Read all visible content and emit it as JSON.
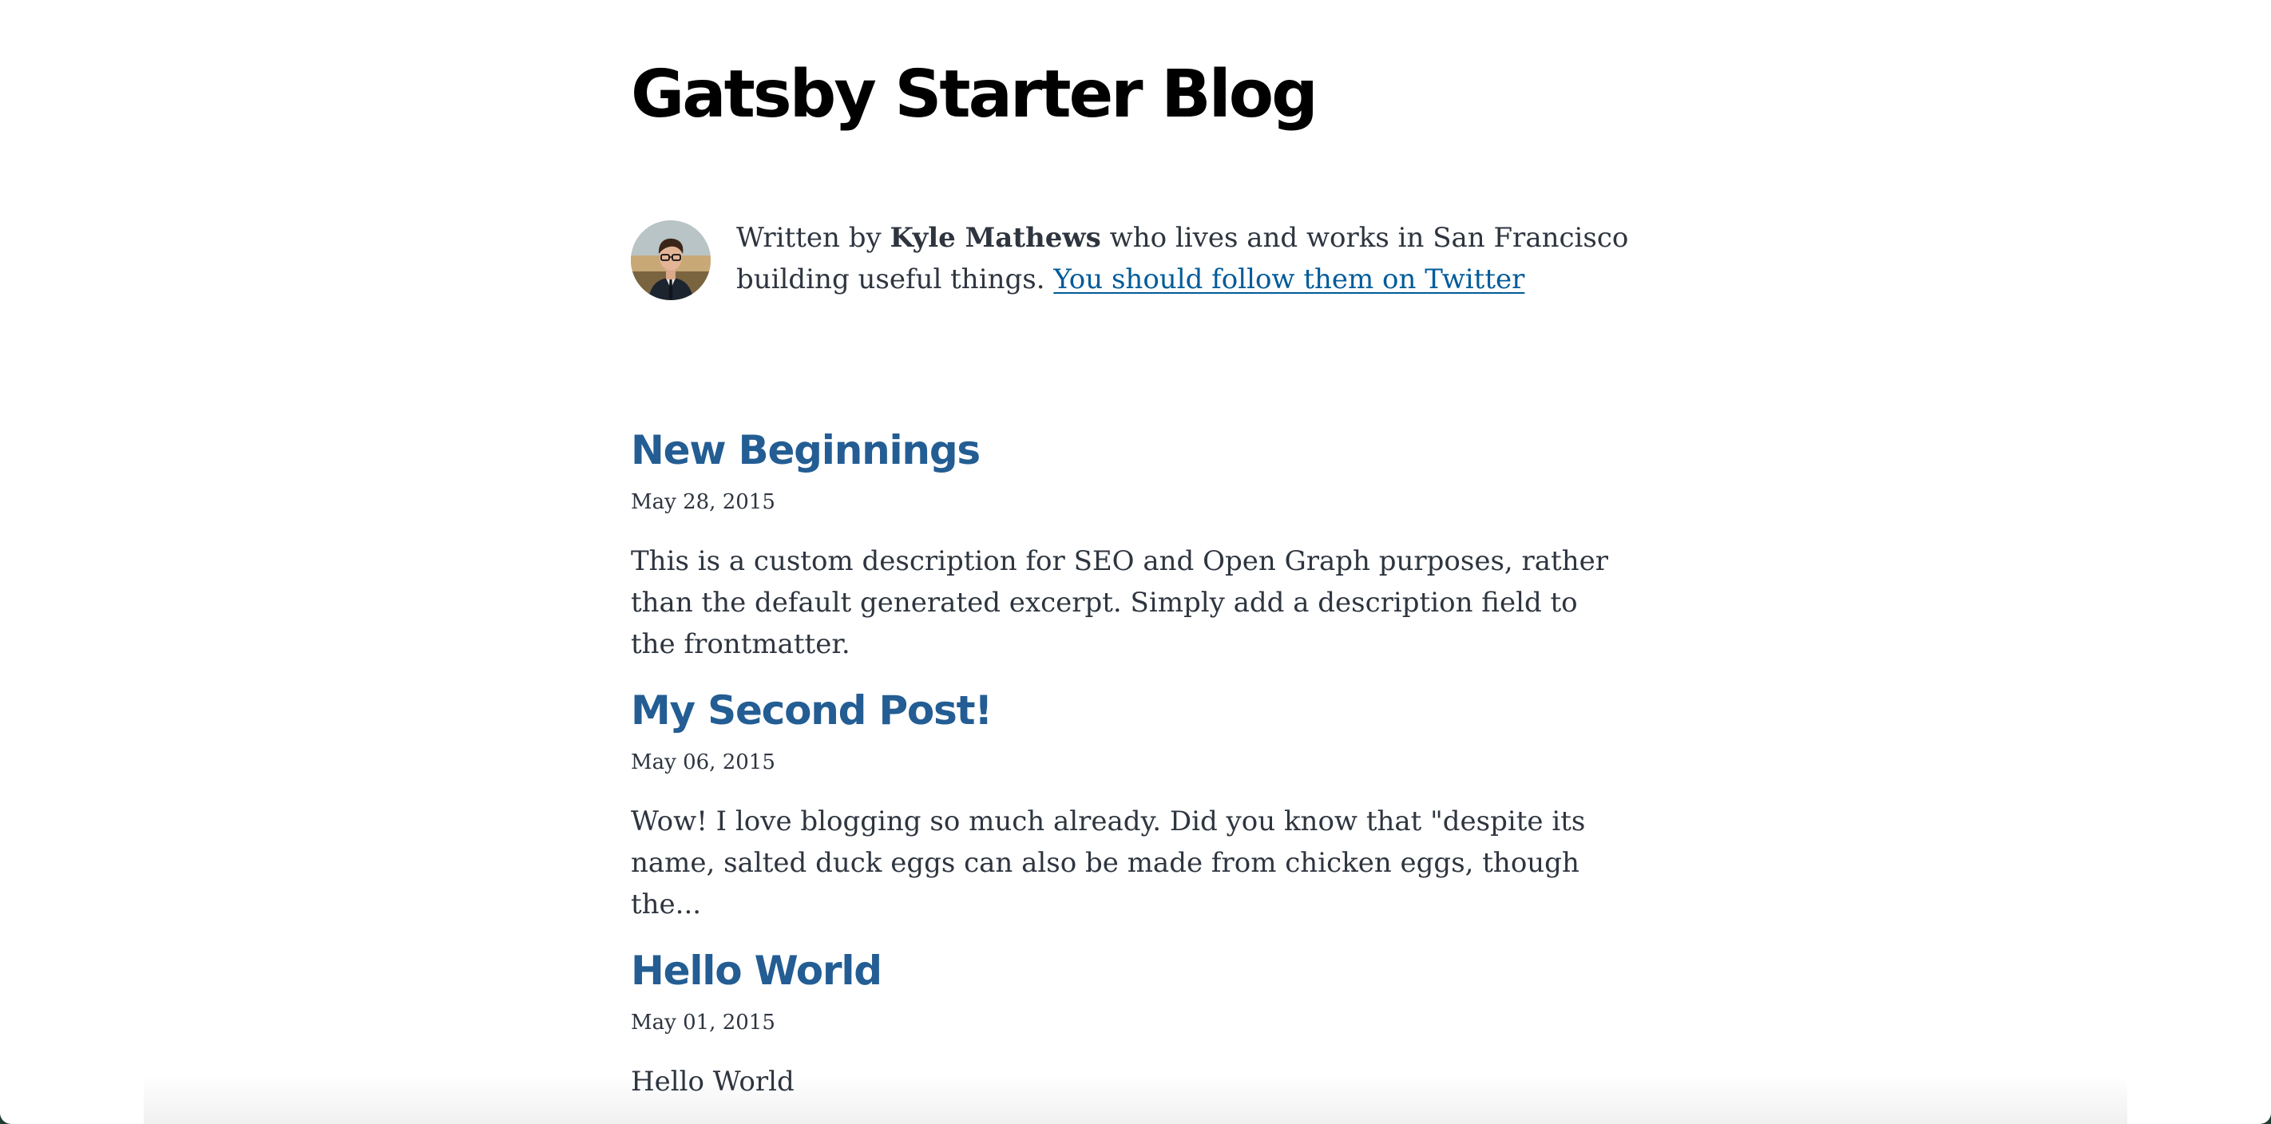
{
  "site": {
    "title": "Gatsby Starter Blog"
  },
  "bio": {
    "prefix": "Written by ",
    "author": "Kyle Mathews",
    "middle": " who lives and works in San Francisco building useful things. ",
    "link_text": "You should follow them on Twitter"
  },
  "posts": [
    {
      "title": "New Beginnings",
      "date": "May 28, 2015",
      "description": "This is a custom description for SEO and Open Graph purposes, rather than the default generated excerpt. Simply add a description field to the frontmatter."
    },
    {
      "title": "My Second Post!",
      "date": "May 06, 2015",
      "description": "Wow! I love blogging so much already. Did you know that \"despite its name, salted duck eggs can also be made from chicken eggs, though the..."
    },
    {
      "title": "Hello World",
      "date": "May 01, 2015",
      "description": "Hello World"
    }
  ],
  "colors": {
    "title": "#000000",
    "post_title": "#235d93",
    "body_text": "#2e353f",
    "link": "#005b99",
    "background": "#ffffff"
  }
}
